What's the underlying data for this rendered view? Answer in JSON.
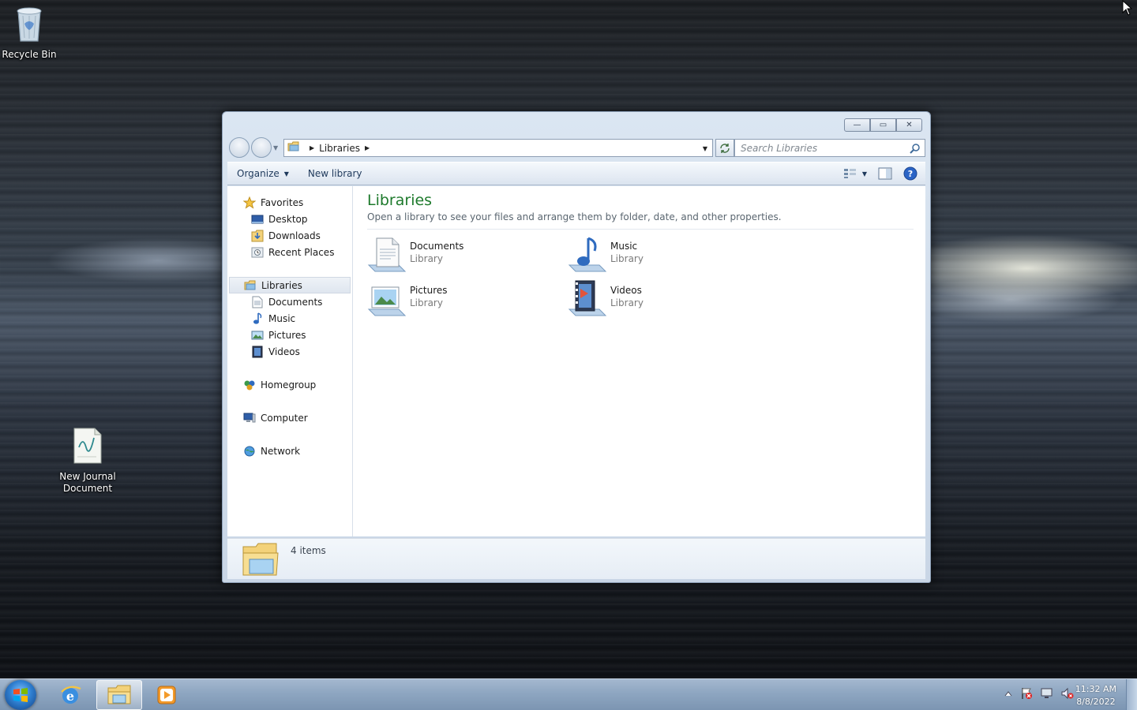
{
  "desktop": {
    "icons": [
      {
        "label": "Recycle Bin",
        "icon": "recycle-bin-icon"
      },
      {
        "label": "New Journal Document",
        "icon": "journal-document-icon"
      }
    ]
  },
  "window": {
    "caption_buttons": {
      "minimize": "—",
      "maximize": "▭",
      "close": "✕"
    },
    "address": {
      "root_icon": "libraries-folder-icon",
      "crumbs": [
        "Libraries"
      ]
    },
    "search": {
      "placeholder": "Search Libraries"
    },
    "toolbar": {
      "organize_label": "Organize",
      "new_library_label": "New library"
    },
    "nav_pane": {
      "favorites": {
        "label": "Favorites",
        "items": [
          "Desktop",
          "Downloads",
          "Recent Places"
        ]
      },
      "libraries": {
        "label": "Libraries",
        "items": [
          "Documents",
          "Music",
          "Pictures",
          "Videos"
        ]
      },
      "homegroup": "Homegroup",
      "computer": "Computer",
      "network": "Network"
    },
    "main": {
      "title": "Libraries",
      "subtitle": "Open a library to see your files and arrange them by folder, date, and other properties.",
      "libraries": [
        {
          "name": "Documents",
          "type": "Library",
          "icon": "documents-library-icon"
        },
        {
          "name": "Music",
          "type": "Library",
          "icon": "music-library-icon"
        },
        {
          "name": "Pictures",
          "type": "Library",
          "icon": "pictures-library-icon"
        },
        {
          "name": "Videos",
          "type": "Library",
          "icon": "videos-library-icon"
        }
      ]
    },
    "details": {
      "count": "4 items"
    }
  },
  "taskbar": {
    "apps": [
      "start-orb",
      "internet-explorer",
      "windows-explorer",
      "media-player"
    ],
    "clock": {
      "time": "11:32 AM",
      "date": "8/8/2022"
    }
  },
  "colors": {
    "title_green": "#1e7a2c",
    "toolbar_text": "#1e395b",
    "taskbar": "#8ea6c1"
  }
}
